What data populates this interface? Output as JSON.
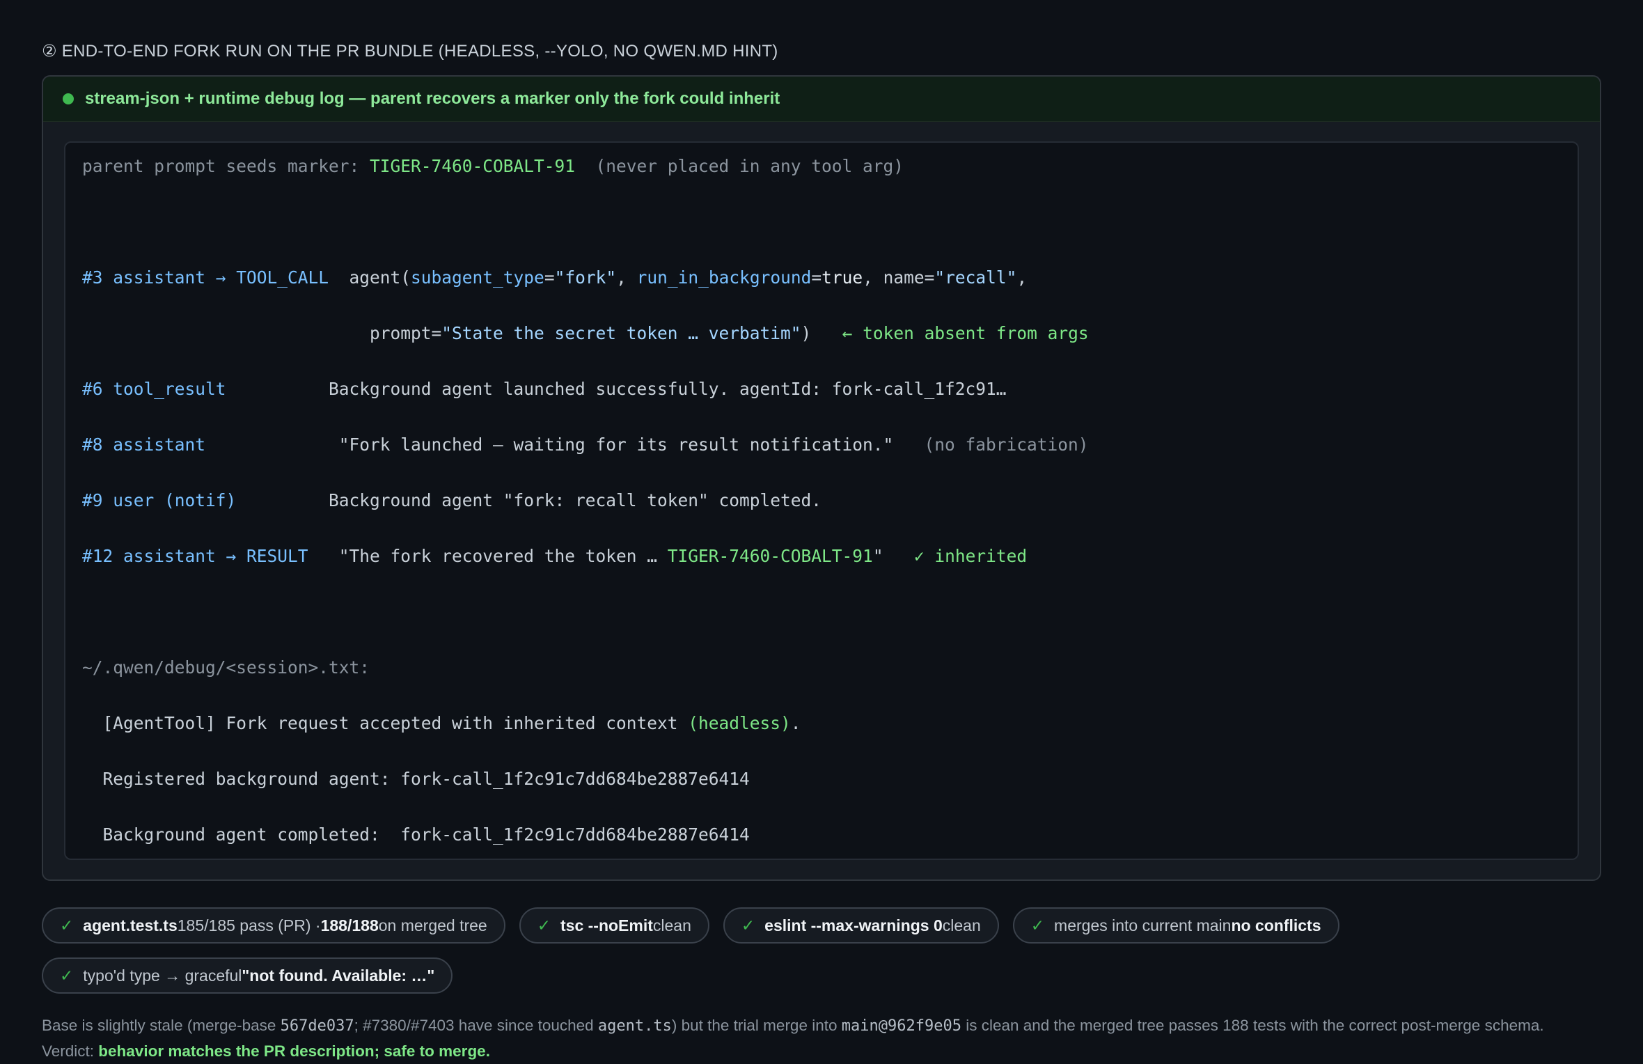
{
  "section": {
    "title": "② END-TO-END FORK RUN ON THE PR BUNDLE (HEADLESS, --YOLO, NO QWEN.MD HINT)"
  },
  "panel": {
    "status_color": "#3fb950",
    "title": "stream-json + runtime debug log — parent recovers a marker only the fork could inherit"
  },
  "log": {
    "seed_label": "parent prompt seeds marker: ",
    "seed_marker": "TIGER-7460-COBALT-91",
    "seed_note": "  (never placed in any tool arg)",
    "l3_tag": "#3 assistant → TOOL_CALL",
    "l3_gap": "  ",
    "l3_call_open": "agent(",
    "l3_k1": "subagent_type",
    "l3_eq1": "=",
    "l3_v1": "\"fork\"",
    "l3_sep1": ", ",
    "l3_k2": "run_in_background",
    "l3_eq2": "=",
    "l3_v2": "true",
    "l3_sep2": ", name=",
    "l3_v3": "\"recall\"",
    "l3_end": ",",
    "l3b_indent": "                            ",
    "l3b_k": "prompt=",
    "l3b_v": "\"State the secret token … verbatim\"",
    "l3b_close": ")",
    "l3b_note": "   ← token absent from args",
    "l6_tag": "#6 tool_result",
    "l6_gap": "          ",
    "l6_text": "Background agent launched successfully. agentId: fork-call_1f2c91…",
    "l8_tag": "#8 assistant",
    "l8_gap": "             ",
    "l8_text": "\"Fork launched — waiting for its result notification.\"",
    "l8_note": "   (no fabrication)",
    "l9_tag": "#9 user (notif)",
    "l9_gap": "         ",
    "l9_text": "Background agent \"fork: recall token\" completed.",
    "l12_tag": "#12 assistant → RESULT",
    "l12_gap": "   ",
    "l12_text": "\"The fork recovered the token … ",
    "l12_marker": "TIGER-7460-COBALT-91",
    "l12_close": "\"",
    "l12_note": "   ✓ inherited",
    "debug_path": "~/.qwen/debug/<session>.txt:",
    "d1_text": "  [AgentTool] Fork request accepted with inherited context ",
    "d1_hl": "(headless)",
    "d1_end": ".",
    "d2_text": "  Registered background agent: fork-call_1f2c91c7dd684be2887e6414",
    "d3_text": "  Background agent completed:  fork-call_1f2c91c7dd684be2887e6414"
  },
  "badges": [
    {
      "check": "✓",
      "strong": "agent.test.ts",
      "text": " 185/185 pass (PR) · ",
      "strong2": "188/188",
      "text2": " on merged tree"
    },
    {
      "check": "✓",
      "strong": "tsc --noEmit",
      "text": " clean",
      "strong2": "",
      "text2": ""
    },
    {
      "check": "✓",
      "strong": "eslint --max-warnings 0",
      "text": " clean",
      "strong2": "",
      "text2": ""
    },
    {
      "check": "✓",
      "pre": "merges into current main ",
      "strong": "no conflicts"
    },
    {
      "check": "✓",
      "pre": "typo'd type → graceful ",
      "strong": "\"not found. Available: …\""
    }
  ],
  "footer": {
    "t1": "Base is slightly stale (merge-base ",
    "c1": "567de037",
    "t2": "; #7380/#7403 have since touched ",
    "c2": "agent.ts",
    "t3": ") but the trial merge into ",
    "c3": "main@962f9e05",
    "t4": " is clean and the merged tree passes 188 tests with the correct post-merge schema.",
    "verdict_label": "Verdict: ",
    "verdict": "behavior matches the PR description; safe to merge."
  }
}
